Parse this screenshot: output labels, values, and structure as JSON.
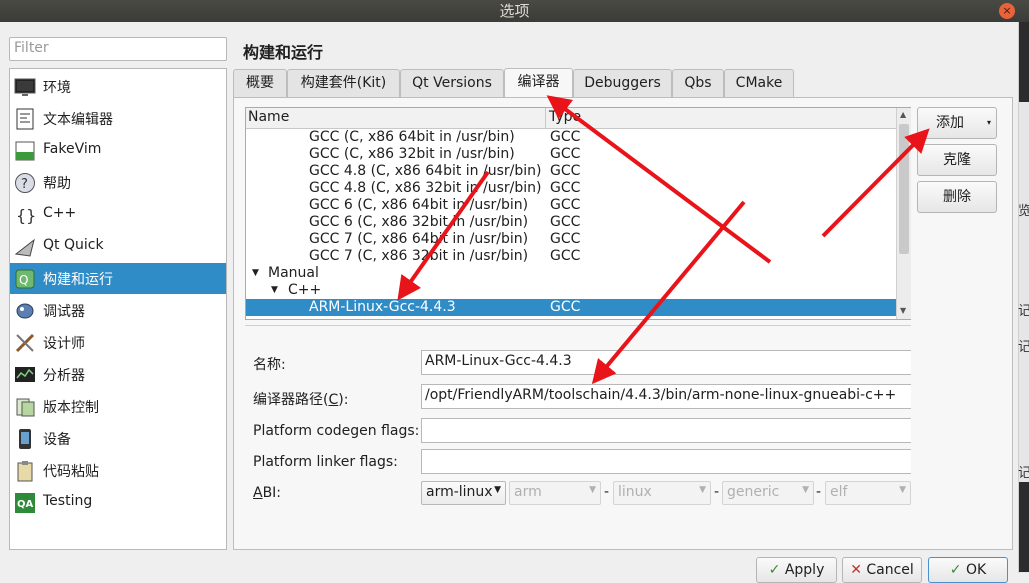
{
  "window": {
    "title": "选项",
    "close_glyph": "×"
  },
  "filter": {
    "placeholder": "Filter"
  },
  "sidebar": {
    "items": [
      {
        "label": "环境",
        "icon": "monitor-icon"
      },
      {
        "label": "文本编辑器",
        "icon": "text-editor-icon"
      },
      {
        "label": "FakeVim",
        "icon": "fakevim-icon"
      },
      {
        "label": "帮助",
        "icon": "help-icon"
      },
      {
        "label": "C++",
        "icon": "cpp-braces-icon"
      },
      {
        "label": "Qt Quick",
        "icon": "qt-quick-icon"
      },
      {
        "label": "构建和运行",
        "icon": "build-run-icon"
      },
      {
        "label": "调试器",
        "icon": "debugger-icon"
      },
      {
        "label": "设计师",
        "icon": "designer-icon"
      },
      {
        "label": "分析器",
        "icon": "analyzer-icon"
      },
      {
        "label": "版本控制",
        "icon": "version-control-icon"
      },
      {
        "label": "设备",
        "icon": "device-icon"
      },
      {
        "label": "代码粘贴",
        "icon": "code-paste-icon"
      },
      {
        "label": "Testing",
        "icon": "testing-qa-icon"
      }
    ],
    "selected": "构建和运行"
  },
  "page": {
    "title": "构建和运行"
  },
  "tabs": [
    {
      "label": "概要"
    },
    {
      "label": "构建套件(Kit)"
    },
    {
      "label": "Qt Versions"
    },
    {
      "label": "编译器"
    },
    {
      "label": "Debuggers"
    },
    {
      "label": "Qbs"
    },
    {
      "label": "CMake"
    }
  ],
  "active_tab": "编译器",
  "tree": {
    "headers": {
      "name": "Name",
      "type": "Type"
    },
    "auto_rows": [
      {
        "name": "GCC (C, x86 64bit in /usr/bin)",
        "type": "GCC"
      },
      {
        "name": "GCC (C, x86 32bit in /usr/bin)",
        "type": "GCC"
      },
      {
        "name": "GCC 4.8 (C, x86 64bit in /usr/bin)",
        "type": "GCC"
      },
      {
        "name": "GCC 4.8 (C, x86 32bit in /usr/bin)",
        "type": "GCC"
      },
      {
        "name": "GCC 6 (C, x86 64bit in /usr/bin)",
        "type": "GCC"
      },
      {
        "name": "GCC 6 (C, x86 32bit in /usr/bin)",
        "type": "GCC"
      },
      {
        "name": "GCC 7 (C, x86 64bit in /usr/bin)",
        "type": "GCC"
      },
      {
        "name": "GCC 7 (C, x86 32bit in /usr/bin)",
        "type": "GCC"
      }
    ],
    "manual_label": "Manual",
    "cpp_label": "C++",
    "selected_row": {
      "name": "ARM-Linux-Gcc-4.4.3",
      "type": "GCC"
    }
  },
  "buttons": {
    "add": "添加",
    "clone": "克隆",
    "remove": "删除"
  },
  "form": {
    "name_label": "名称:",
    "name_value": "ARM-Linux-Gcc-4.4.3",
    "path_label_prefix": "编译器路径(",
    "path_label_mnemonic": "C",
    "path_label_suffix": "):",
    "path_value": "/opt/FriendlyARM/toolschain/4.4.3/bin/arm-none-linux-gnueabi-c++",
    "codegen_label": "Platform codegen flags:",
    "codegen_value": "",
    "linker_label": "Platform linker flags:",
    "linker_value": "",
    "abi_label_mnemonic": "A",
    "abi_label_rest": "BI:",
    "abi_values": [
      "arm-linux",
      "arm",
      "linux",
      "generic",
      "elf"
    ],
    "abi_sep": "-"
  },
  "bottom": {
    "apply": "Apply",
    "cancel": "Cancel",
    "ok": "OK"
  },
  "colors": {
    "selection": "#308cc6",
    "arrow": "#e8141a"
  },
  "right_edge": {
    "chars": [
      "览",
      "记",
      "记",
      "记"
    ]
  }
}
